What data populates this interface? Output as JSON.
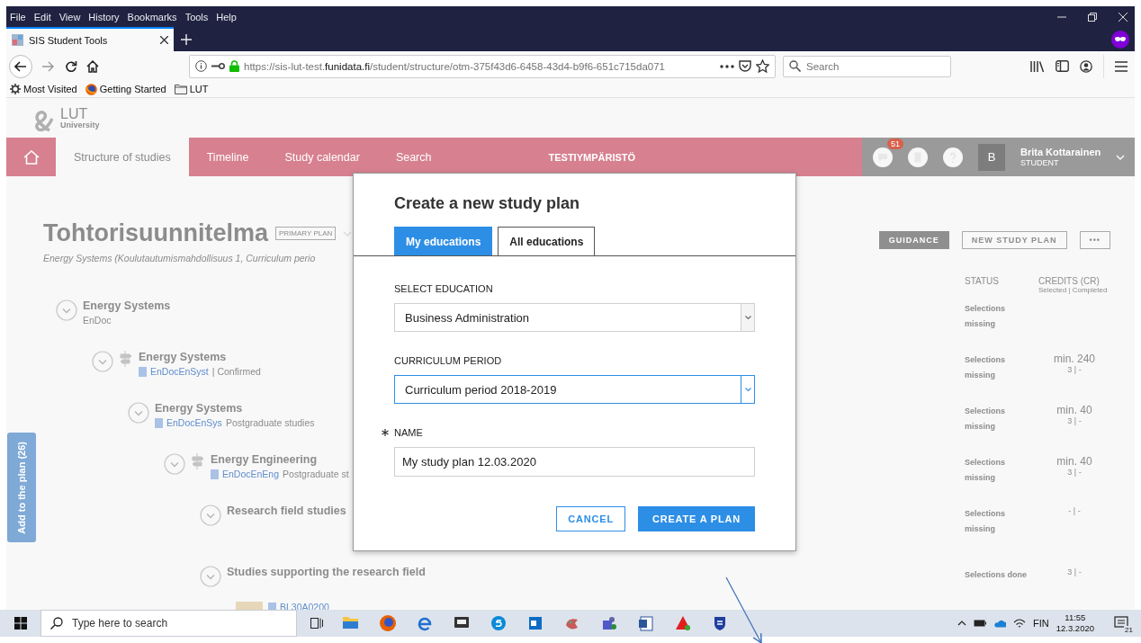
{
  "browser": {
    "menu": [
      "File",
      "Edit",
      "View",
      "History",
      "Bookmarks",
      "Tools",
      "Help"
    ],
    "tab": {
      "title": "SIS Student Tools"
    },
    "url": "https://sis-lut-test.**funidata.fi**/student/structure/otm-375f43d6-6458-43d4-b9f6-651c715da071",
    "search": {
      "placeholder": "Search"
    },
    "bookmarks": [
      {
        "label": "Most Visited",
        "kind": "smart"
      },
      {
        "label": "Getting Started",
        "kind": "page"
      },
      {
        "label": "LUT",
        "kind": "folder"
      }
    ]
  },
  "app": {
    "logo": {
      "name": "LUT",
      "sub": "University"
    },
    "nav": [
      {
        "label": "Structure of studies",
        "selected": true
      },
      {
        "label": "Timeline",
        "selected": false
      },
      {
        "label": "Study calendar",
        "selected": false
      },
      {
        "label": "Search",
        "selected": false
      }
    ],
    "environment": "TESTIYMPÄRISTÖ",
    "notifications": "51",
    "user": {
      "initial": "B",
      "name": "Brita Kottarainen",
      "role": "STUDENT"
    },
    "plan": {
      "title": "Tohtorisuunnitelma",
      "badge": "PRIMARY PLAN",
      "subtitle": "Energy Systems (Koulutautumismahdollisuus 1, Curriculum perio"
    },
    "actions": [
      {
        "label": "GUIDANCE",
        "kind": "filled"
      },
      {
        "label": "NEW STUDY PLAN",
        "kind": "outline"
      },
      {
        "label": "•••",
        "kind": "outline"
      }
    ],
    "columns": {
      "status": "STATUS",
      "credits": "CREDITS (CR)",
      "credits_sub": "Selected | Completed"
    },
    "side_button": "Add to the plan (26)",
    "tree": [
      {
        "kind": "module",
        "title": "Energy Systems",
        "subtitle": "EnDoc",
        "rule": false,
        "status": "Selections missing",
        "children": [
          {
            "kind": "module",
            "title": "Energy Systems",
            "code": "EnDocEnSyst",
            "tail": "| Confirmed",
            "rule": true,
            "status": "Selections missing",
            "credits": "min. 240",
            "credits_sub": "3 | -",
            "children": [
              {
                "kind": "module",
                "title": "Energy Systems",
                "code": "EnDocEnSys",
                "tail": "Postgraduate studies",
                "rule": false,
                "status": "Selections missing",
                "credits": "min. 40",
                "credits_sub": "3 | -",
                "children": [
                  {
                    "kind": "module",
                    "title": "Energy Engineering",
                    "code": "EnDocEnEng",
                    "tail": "Postgraduate st",
                    "rule": true,
                    "status": "Selections missing",
                    "credits": "min. 40",
                    "credits_sub": "3 | -",
                    "children": [
                      {
                        "kind": "module",
                        "title": "Research field studies",
                        "rule": false,
                        "status": "Selections missing",
                        "credits_sub": "- | -"
                      },
                      {
                        "kind": "module",
                        "title": "Studies supporting the research field",
                        "rule": false,
                        "status": "Selections done",
                        "credits_sub": "3 | -",
                        "children": [
                          {
                            "kind": "course",
                            "code": "BL30A0200"
                          }
                        ]
                      }
                    ]
                  }
                ]
              }
            ]
          }
        ]
      }
    ]
  },
  "dialog": {
    "title": "Create a new study plan",
    "tabs": [
      {
        "label": "My educations",
        "selected": true
      },
      {
        "label": "All educations",
        "selected": false
      }
    ],
    "fields": [
      {
        "kind": "select",
        "label": "SELECT EDUCATION",
        "value": "Business Administration",
        "focused": false,
        "required": false
      },
      {
        "kind": "select",
        "label": "CURRICULUM PERIOD",
        "value": "Curriculum period 2018-2019",
        "focused": true,
        "required": false
      },
      {
        "kind": "text",
        "label": "NAME",
        "value": "My study plan 12.03.2020",
        "focused": false,
        "required": true
      }
    ],
    "buttons": [
      {
        "label": "CANCEL",
        "kind": "secondary"
      },
      {
        "label": "CREATE A PLAN",
        "kind": "primary"
      }
    ]
  },
  "taskbar": {
    "search": {
      "placeholder": "Type here to search"
    },
    "language": "FIN",
    "time": "11:55",
    "date": "12.3.2020",
    "notifications": "21"
  }
}
